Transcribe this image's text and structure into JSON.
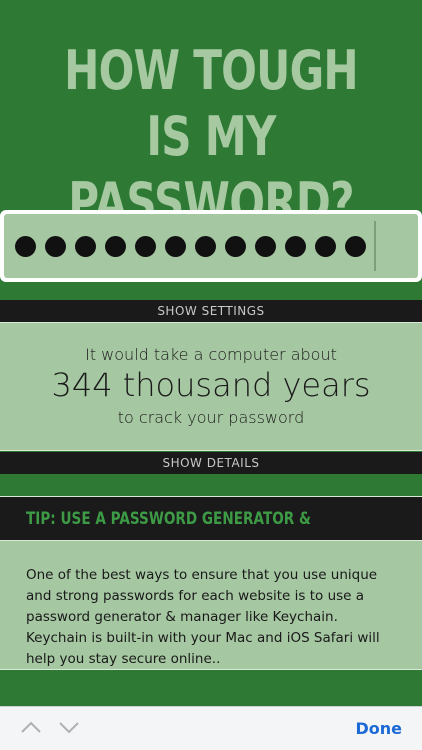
{
  "header": {
    "title": "HOW TOUGH IS MY PASSWORD?"
  },
  "password": {
    "masked_count": 12
  },
  "settings_bar": {
    "label": "SHOW SETTINGS"
  },
  "result": {
    "line1": "It would take a computer about",
    "line2": "344 thousand years",
    "line3": "to crack your password"
  },
  "details_bar": {
    "label": "SHOW DETAILS"
  },
  "tip": {
    "title": "TIP: USE A PASSWORD GENERATOR & MANAGER",
    "body": "One of the best ways to ensure that you use unique and strong passwords for each website is to use a password generator & manager like Keychain. Keychain is built-in with your Mac and iOS Safari will help you stay secure online.."
  },
  "keyboard_toolbar": {
    "prev_icon": "chevron-up-icon",
    "next_icon": "chevron-down-icon",
    "done_label": "Done"
  },
  "colors": {
    "background": "#2e7a35",
    "panel": "#a5c7a1",
    "title": "#a6c9a2",
    "bar": "#1a1a1a",
    "tip_title": "#3d9a45",
    "done": "#1b6ad6"
  }
}
